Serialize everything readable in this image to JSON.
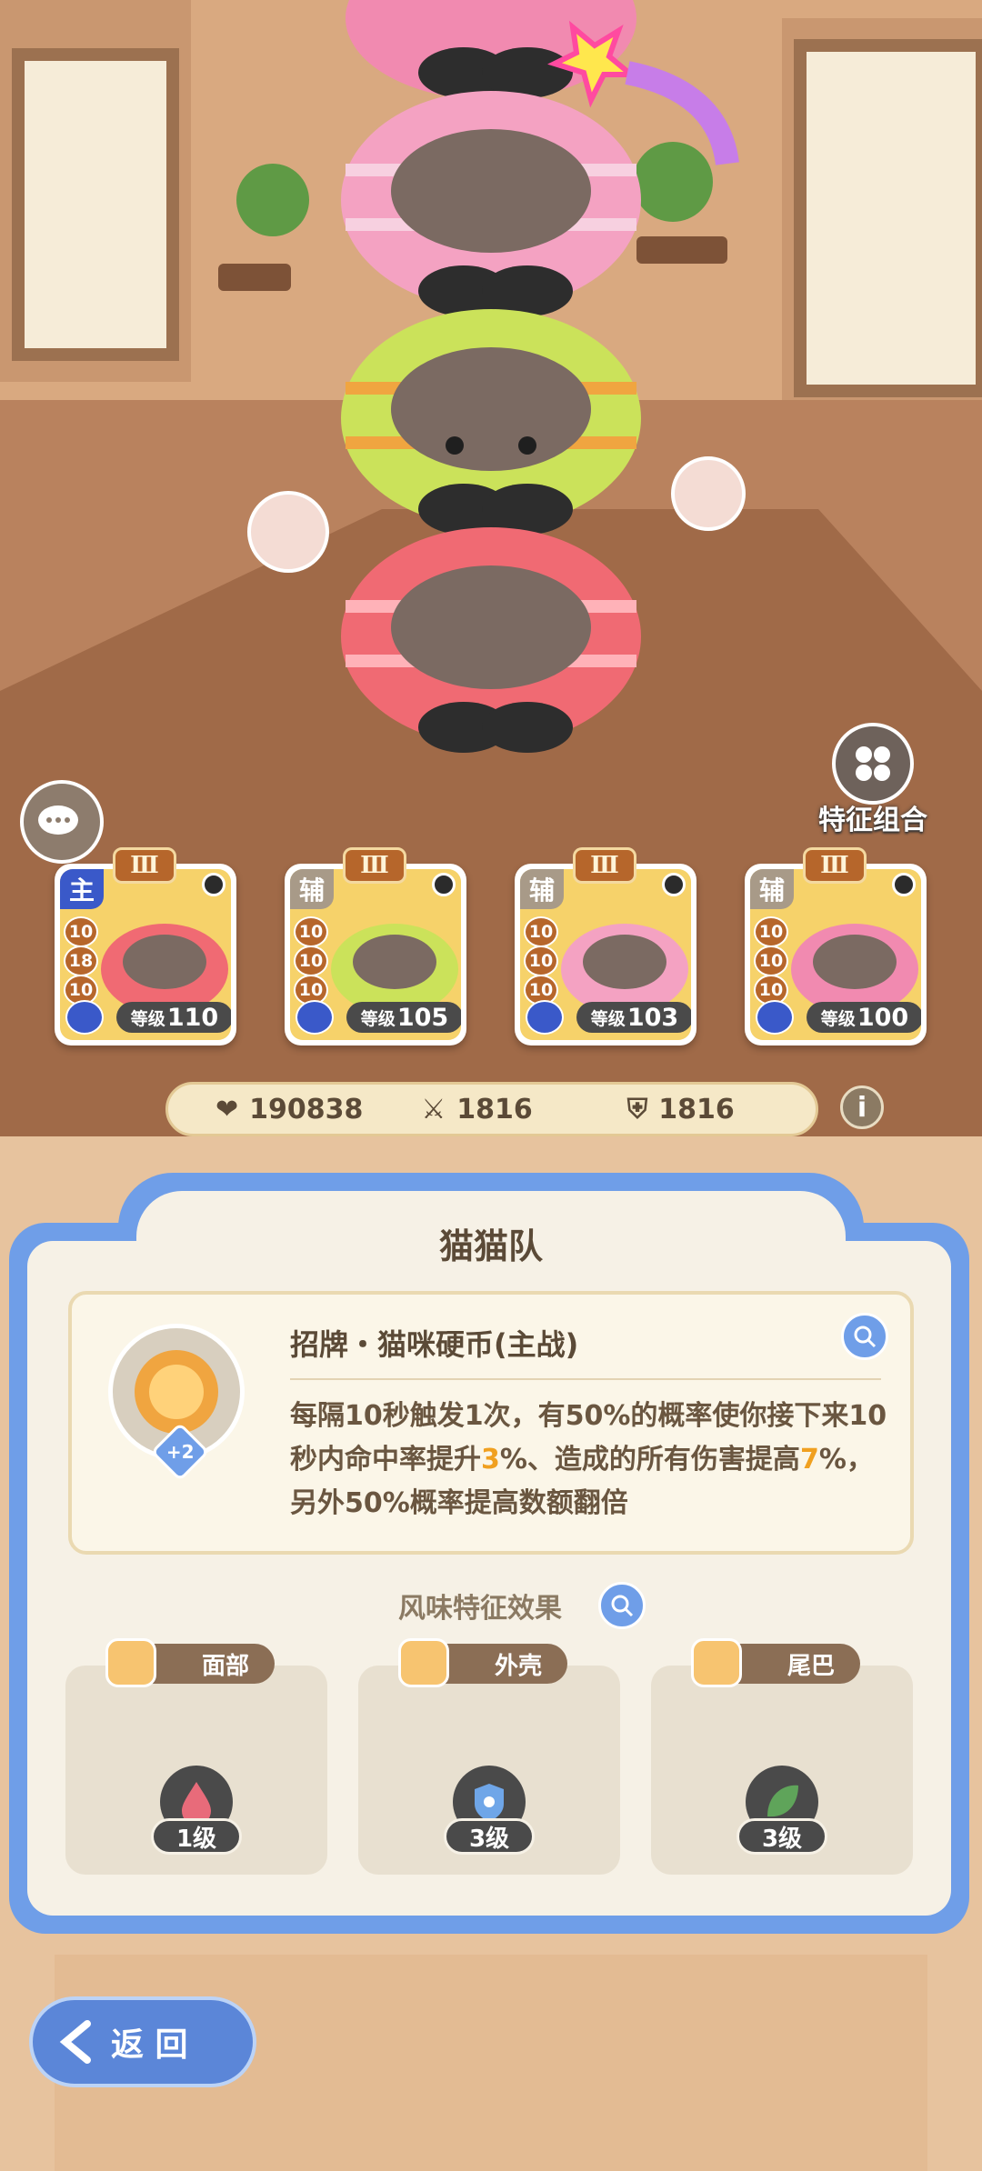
{
  "top_right": {
    "feature_combo_label": "特征组合"
  },
  "team_cards": [
    {
      "role": "主",
      "role_color": "#3a59c9",
      "rank": "Ⅲ",
      "stats": [
        "10",
        "18",
        "10"
      ],
      "level_label": "等级",
      "level": "110"
    },
    {
      "role": "辅",
      "role_color": "#a89a88",
      "rank": "Ⅲ",
      "stats": [
        "10",
        "10",
        "10"
      ],
      "level_label": "等级",
      "level": "105"
    },
    {
      "role": "辅",
      "role_color": "#a89a88",
      "rank": "Ⅲ",
      "stats": [
        "10",
        "10",
        "10"
      ],
      "level_label": "等级",
      "level": "103"
    },
    {
      "role": "辅",
      "role_color": "#a89a88",
      "rank": "Ⅲ",
      "stats": [
        "10",
        "10",
        "10"
      ],
      "level_label": "等级",
      "level": "100"
    }
  ],
  "stats_bar": {
    "hp": "190838",
    "attack": "1816",
    "defense": "1816"
  },
  "panel": {
    "title": "猫猫队",
    "skill": {
      "name": "招牌・猫咪硬币(主战)",
      "badge": "+2",
      "description_parts": [
        "每隔10秒触发1次，有50%的概率使你接下来10秒内命中率提升",
        "3",
        "%、造成的所有伤害提高",
        "7",
        "%，另外50%概率提高数额翻倍"
      ]
    },
    "flavor_title": "风味特征效果",
    "traits": [
      {
        "label": "面部",
        "level": "1级"
      },
      {
        "label": "外壳",
        "level": "3级"
      },
      {
        "label": "尾巴",
        "level": "3级"
      }
    ]
  },
  "back_button": {
    "label": "返 回"
  },
  "colors": {
    "panel_blue": "#6f9ee8",
    "highlight_orange": "#f0a020",
    "text_brown": "#5b4a37"
  }
}
